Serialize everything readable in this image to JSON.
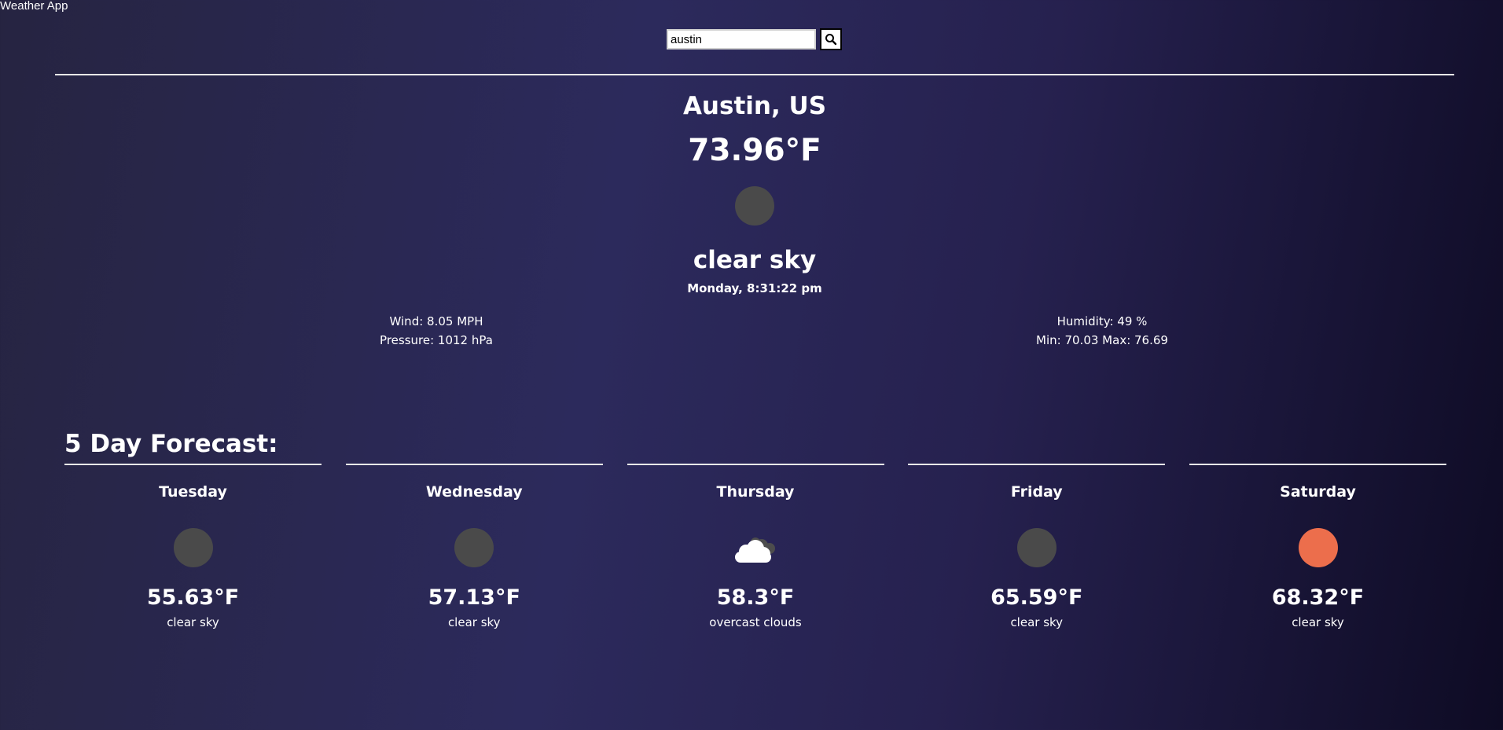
{
  "app": {
    "title": "Weather App"
  },
  "search": {
    "value": "austin",
    "button_icon": "search-icon"
  },
  "current": {
    "location": "Austin, US",
    "temperature": "73.96°F",
    "icon": "clear-night-icon",
    "condition": "clear sky",
    "datetime": "Monday, 8:31:22 pm",
    "wind": "Wind: 8.05 MPH",
    "pressure": "Pressure: 1012 hPa",
    "humidity": "Humidity: 49 %",
    "min_max": "Min: 70.03 Max: 76.69"
  },
  "forecast": {
    "title": "5 Day Forecast:",
    "days": [
      {
        "day": "Tuesday",
        "temp": "55.63°F",
        "condition": "clear sky",
        "icon": "clear-night-icon"
      },
      {
        "day": "Wednesday",
        "temp": "57.13°F",
        "condition": "clear sky",
        "icon": "clear-night-icon"
      },
      {
        "day": "Thursday",
        "temp": "58.3°F",
        "condition": "overcast clouds",
        "icon": "overcast-clouds-icon"
      },
      {
        "day": "Friday",
        "temp": "65.59°F",
        "condition": "clear sky",
        "icon": "clear-night-icon"
      },
      {
        "day": "Saturday",
        "temp": "68.32°F",
        "condition": "clear sky",
        "icon": "sun-icon"
      }
    ]
  },
  "colors": {
    "background_start": "#262441",
    "background_mid": "#2c2a5c",
    "background_end": "#0e0b24",
    "moon_icon": "#4a4a4a",
    "sun_icon": "#ec6e4c"
  }
}
